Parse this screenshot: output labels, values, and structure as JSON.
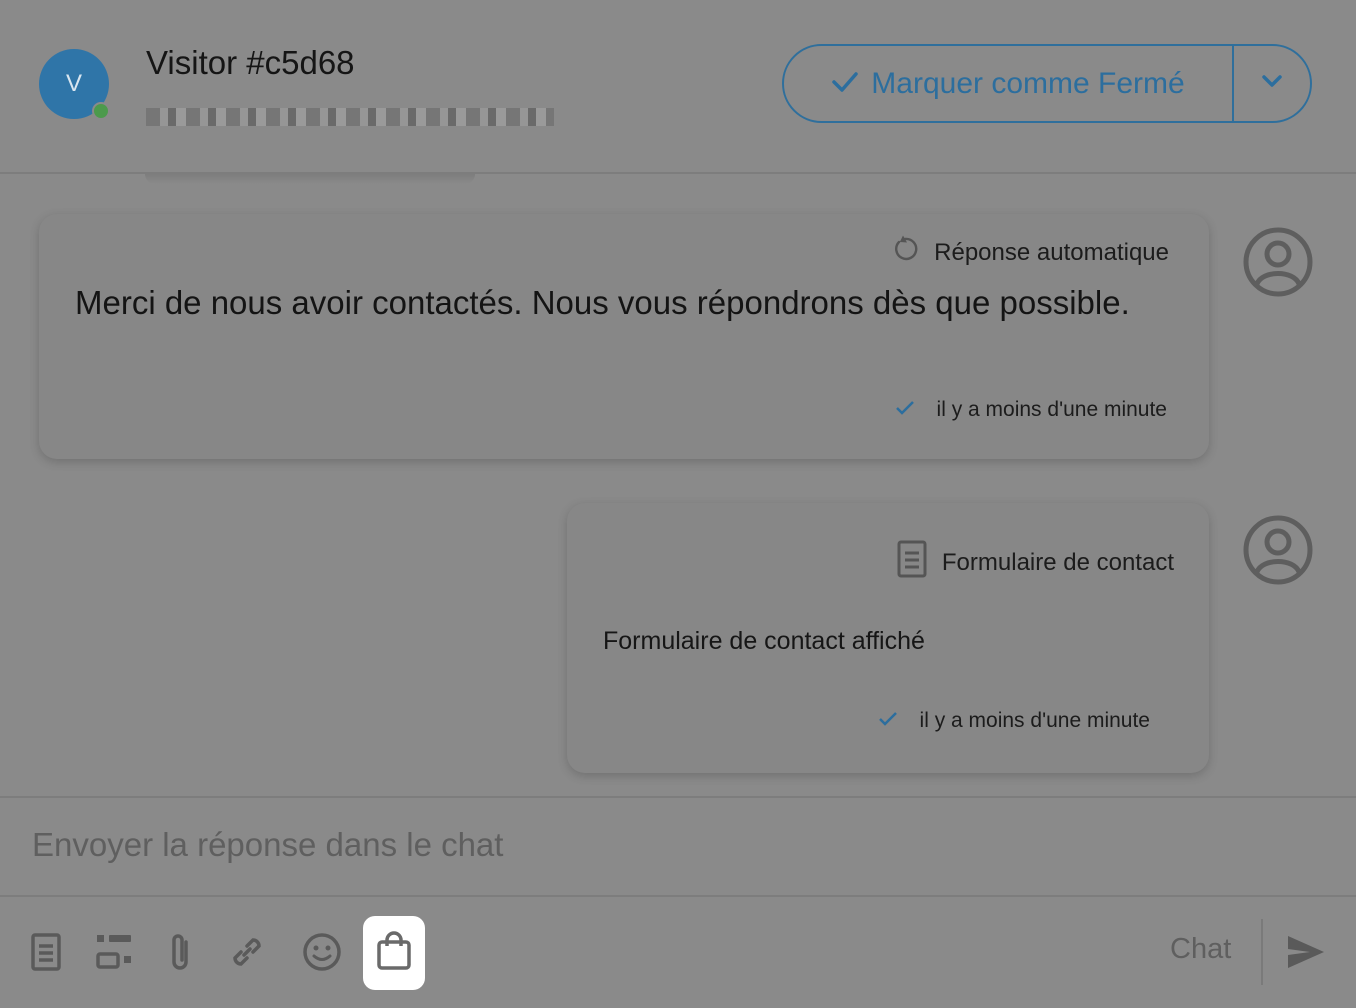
{
  "header": {
    "avatar_letter": "V",
    "visitor_name": "Visitor #c5d68",
    "status_colors": {
      "online": "#4c9a4c",
      "avatar": "#2f75a8"
    },
    "close_button_label": "Marquer comme Fermé",
    "close_button_icon": "check-icon",
    "dropdown_icon": "chevron-down-icon"
  },
  "messages": [
    {
      "type_label": "Réponse automatique",
      "type_icon": "refresh-icon",
      "text": "Merci de nous avoir contactés. Nous vous répondrons dès que possible.",
      "time": "il y a moins d'une minute",
      "status_icon": "check-icon"
    },
    {
      "type_label": "Formulaire de contact",
      "type_icon": "form-icon",
      "text": "Formulaire de contact affiché",
      "time": "il y a moins d'une minute",
      "status_icon": "check-icon"
    }
  ],
  "composer": {
    "placeholder": "Envoyer la réponse dans le chat",
    "mode_label": "Chat",
    "tools": [
      "form-icon",
      "canned-responses-icon",
      "attachment-icon",
      "link-icon",
      "emoji-icon",
      "shopping-bag-icon"
    ],
    "send_icon": "send-icon"
  },
  "colors": {
    "accent": "#2c6e9e",
    "background": "#8a8a8a"
  }
}
